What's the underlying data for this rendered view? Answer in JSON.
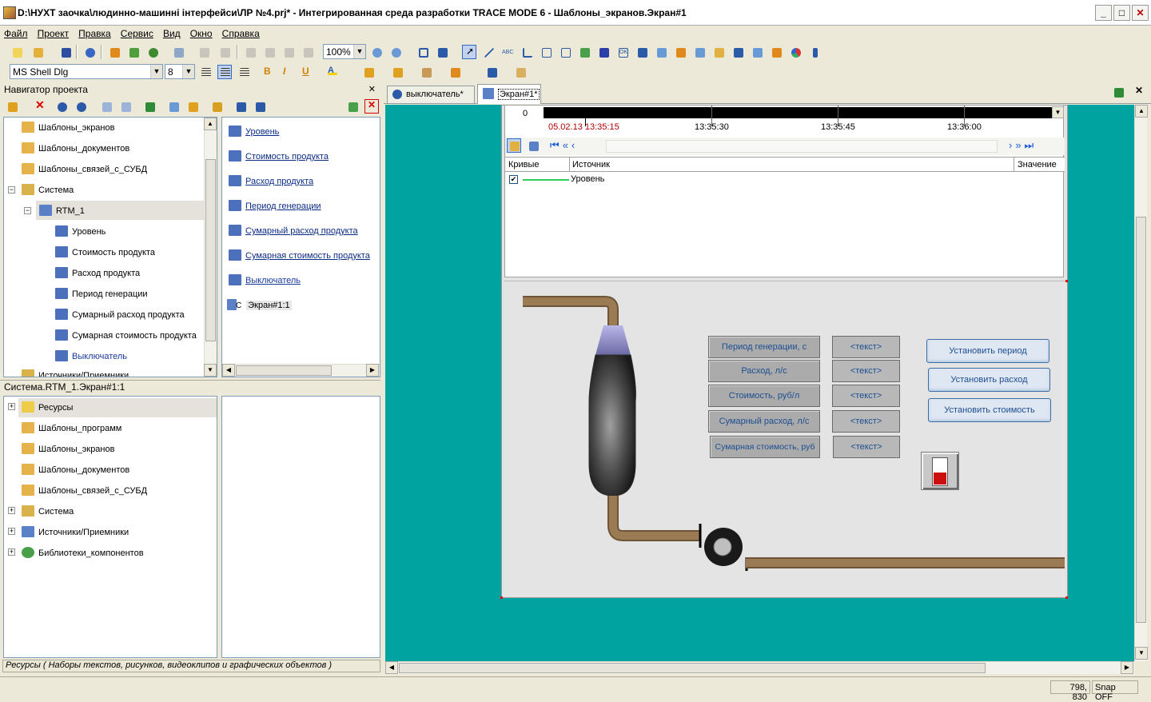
{
  "window": {
    "title": "D:\\НУХТ заочка\\людинно-машинні інтерфейси\\ЛР №4.prj* - Интегрированная среда разработки TRACE MODE 6 - Шаблоны_экранов.Экран#1"
  },
  "menu": [
    "Файл",
    "Проект",
    "Правка",
    "Сервис",
    "Вид",
    "Окно",
    "Справка"
  ],
  "toolbar": {
    "zoom": "100%",
    "font": "MS Shell Dlg",
    "size": "8",
    "bold": "B",
    "italic": "I",
    "underline": "U",
    "text_glyph": "A",
    "abc": "ABC",
    "ok": "OK"
  },
  "navigator": {
    "title": "Навигатор проекта",
    "tree": [
      "Шаблоны_экранов",
      "Шаблоны_документов",
      "Шаблоны_связей_с_СУБД",
      "Система",
      "RTM_1",
      "Уровень",
      "Стоимость продукта",
      "Расход продукта",
      "Период генерации",
      "Сумарный расход продукта",
      "Сумарная стоимость продукта",
      "Выключатель",
      "Источники/Приемники"
    ],
    "list": [
      "Уровень",
      "Стоимость продукта",
      "Расход продукта",
      "Период генерации",
      "Сумарный расход продукта",
      "Сумарная стоимость продукта",
      "Выключатель",
      "Экран#1:1"
    ],
    "list_prefix": "C"
  },
  "resources": {
    "path": "Система.RTM_1.Экран#1:1",
    "tree": [
      "Ресурсы",
      "Шаблоны_программ",
      "Шаблоны_экранов",
      "Шаблоны_документов",
      "Шаблоны_связей_с_СУБД",
      "Система",
      "Источники/Приемники",
      "Библиотеки_компонентов"
    ],
    "status": "Ресурсы ( Наборы текстов, рисунков, видеоклипов и графических объектов )"
  },
  "tabs": [
    {
      "label": "выключатель*"
    },
    {
      "label": "Экран#1*"
    }
  ],
  "trend": {
    "zero": "0",
    "date": "05.02.13",
    "times": [
      "13:35:15",
      "13:35:30",
      "13:35:45",
      "13:36:00"
    ],
    "cols": [
      "Кривые",
      "Источник",
      "Значение"
    ],
    "row": "Уровень"
  },
  "screen": {
    "labels": [
      "Период генерации, с",
      "Расход, л/с",
      "Стоимость, руб/л",
      "Сумарный расход, л/с",
      "Сумарная стоимость, руб"
    ],
    "text_placeholder": "<текст>",
    "buttons": [
      "Установить период",
      "Установить расход",
      "Установить стоимость"
    ]
  },
  "statusbar": {
    "coords": "798, 830",
    "snap": "Snap OFF"
  },
  "colors": {
    "teal": "#00a3a0",
    "canvas": "#e4e4e4",
    "pipe": "#9b7b53",
    "link": "#0b2c86"
  }
}
